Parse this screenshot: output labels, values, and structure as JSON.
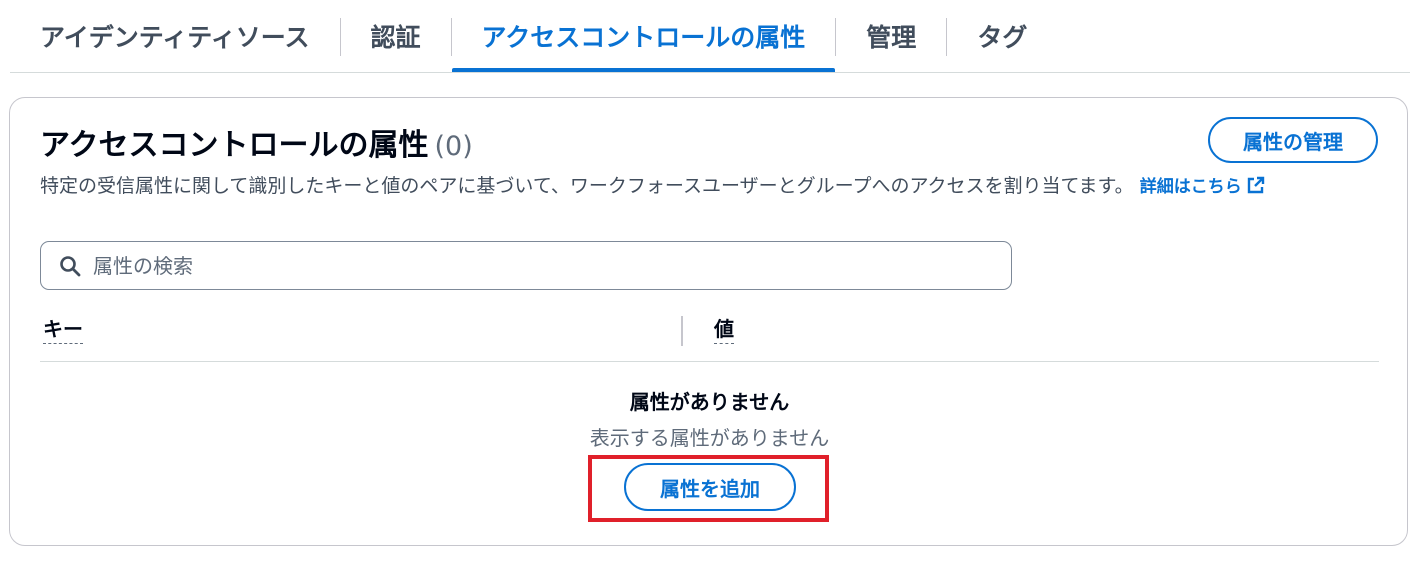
{
  "tabs": [
    {
      "label": "アイデンティティソース",
      "active": false
    },
    {
      "label": "認証",
      "active": false
    },
    {
      "label": "アクセスコントロールの属性",
      "active": true
    },
    {
      "label": "管理",
      "active": false
    },
    {
      "label": "タグ",
      "active": false
    }
  ],
  "panel": {
    "title": "アクセスコントロールの属性",
    "count": "(0)",
    "manage_button": "属性の管理",
    "description": "特定の受信属性に関して識別したキーと値のペアに基づいて、ワークフォースユーザーとグループへのアクセスを割り当てます。",
    "learn_more": "詳細はこちら",
    "learn_more_icon": "external-link-icon",
    "search_icon": "search-icon",
    "search_placeholder": "属性の検索",
    "search_value": "",
    "columns": {
      "key": "キー",
      "value": "値"
    },
    "empty_title": "属性がありません",
    "empty_subtitle": "表示する属性がありません",
    "add_button": "属性を追加"
  },
  "colors": {
    "accent": "#0972d3",
    "highlight": "#e0202a",
    "text": "#16191f",
    "muted": "#5f6b7a"
  }
}
